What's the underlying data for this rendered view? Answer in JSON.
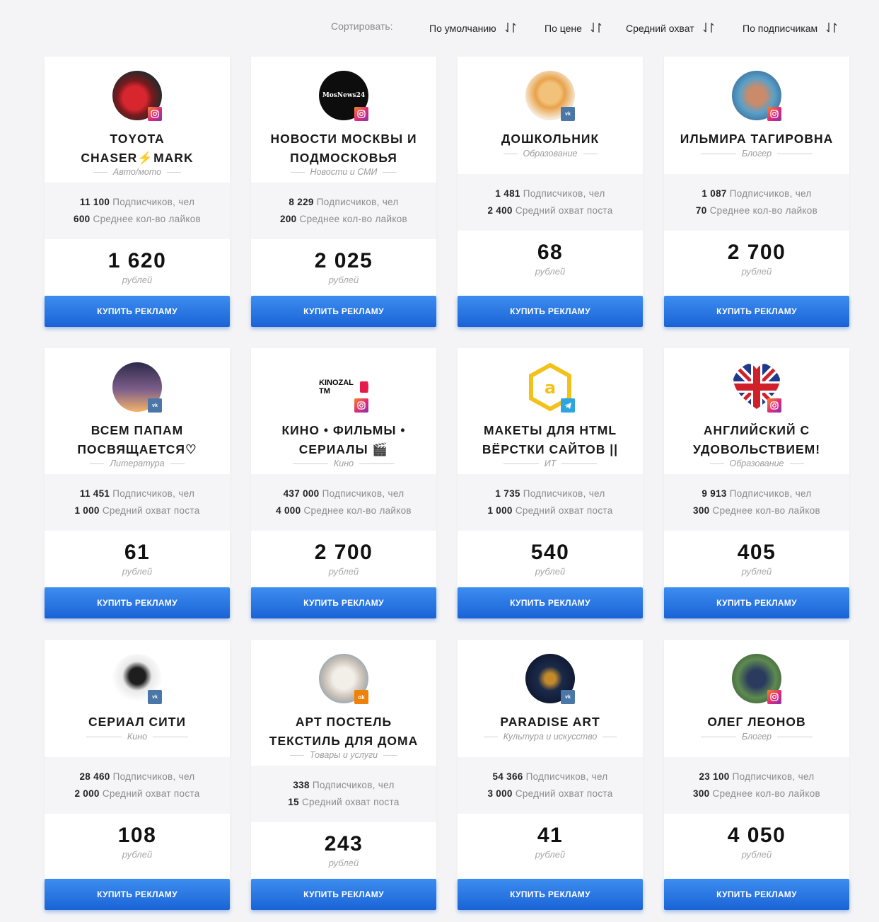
{
  "sort": {
    "label": "Сортировать:",
    "options": [
      "По умолчанию",
      "По цене",
      "Средний охват",
      "По подписчикам"
    ]
  },
  "buy_label": "КУПИТЬ РЕКЛАМУ",
  "price_unit": "рублей",
  "cards": [
    {
      "network": "instagram",
      "title_l1": "TOYOTA",
      "title_l2": "CHASER⚡MARK",
      "category": "Авто/мото",
      "stat1_value": "11 100",
      "stat1_label": "Подписчиков, чел",
      "stat2_value": "600",
      "stat2_label": "Среднее кол-во лайков",
      "price": "1 620"
    },
    {
      "network": "instagram",
      "title_l1": "НОВОСТИ МОСКВЫ И",
      "title_l2": "ПОДМОСКОВЬЯ",
      "category": "Новости и СМИ",
      "avatar_text": "MosNews24",
      "stat1_value": "8 229",
      "stat1_label": "Подписчиков, чел",
      "stat2_value": "200",
      "stat2_label": "Среднее кол-во лайков",
      "price": "2 025"
    },
    {
      "network": "vk",
      "title_l1": "ДОШКОЛЬНИК",
      "title_l2": "",
      "category": "Образование",
      "stat1_value": "1 481",
      "stat1_label": "Подписчиков, чел",
      "stat2_value": "2 400",
      "stat2_label": "Средний охват поста",
      "price": "68"
    },
    {
      "network": "instagram",
      "title_l1": "ИЛЬМИРА ТАГИРОВНА",
      "title_l2": "",
      "category": "Блогер",
      "stat1_value": "1 087",
      "stat1_label": "Подписчиков, чел",
      "stat2_value": "70",
      "stat2_label": "Среднее кол-во лайков",
      "price": "2 700"
    },
    {
      "network": "vk",
      "title_l1": "ВСЕМ ПАПАМ",
      "title_l2": "ПОСВЯЩАЕТСЯ♡",
      "category": "Литература",
      "stat1_value": "11 451",
      "stat1_label": "Подписчиков, чел",
      "stat2_value": "1 000",
      "stat2_label": "Средний охват поста",
      "price": "61"
    },
    {
      "network": "instagram",
      "title_l1": "КИНО • ФИЛЬМЫ •",
      "title_l2": "СЕРИАЛЫ 🎬",
      "category": "Кино",
      "avatar_text": "KINOZAL TM",
      "stat1_value": "437 000",
      "stat1_label": "Подписчиков, чел",
      "stat2_value": "4 000",
      "stat2_label": "Среднее кол-во лайков",
      "price": "2 700"
    },
    {
      "network": "telegram",
      "title_l1": "МАКЕТЫ ДЛЯ HTML",
      "title_l2": "ВЁРСТКИ САЙТОВ ||",
      "category": "ИТ",
      "avatar_text": "a",
      "stat1_value": "1 735",
      "stat1_label": "Подписчиков, чел",
      "stat2_value": "1 000",
      "stat2_label": "Средний охват поста",
      "price": "540"
    },
    {
      "network": "instagram",
      "title_l1": "АНГЛИЙСКИЙ С",
      "title_l2": "УДОВОЛЬСТВИЕМ!",
      "category": "Образование",
      "stat1_value": "9 913",
      "stat1_label": "Подписчиков, чел",
      "stat2_value": "300",
      "stat2_label": "Среднее кол-во лайков",
      "price": "405"
    },
    {
      "network": "vk",
      "title_l1": "СЕРИАЛ СИТИ",
      "title_l2": "",
      "category": "Кино",
      "stat1_value": "28 460",
      "stat1_label": "Подписчиков, чел",
      "stat2_value": "2 000",
      "stat2_label": "Средний охват поста",
      "price": "108"
    },
    {
      "network": "ok",
      "title_l1": "АРТ ПОСТЕЛЬ",
      "title_l2": "ТЕКСТИЛЬ ДЛЯ ДОМА",
      "category": "Товары и услуги",
      "stat1_value": "338",
      "stat1_label": "Подписчиков, чел",
      "stat2_value": "15",
      "stat2_label": "Средний охват поста",
      "price": "243"
    },
    {
      "network": "vk",
      "title_l1": "PARADISE ART",
      "title_l2": "",
      "category": "Культура и искусство",
      "stat1_value": "54 366",
      "stat1_label": "Подписчиков, чел",
      "stat2_value": "3 000",
      "stat2_label": "Средний охват поста",
      "price": "41"
    },
    {
      "network": "instagram",
      "title_l1": "ОЛЕГ ЛЕОНОВ",
      "title_l2": "",
      "category": "Блогер",
      "stat1_value": "23 100",
      "stat1_label": "Подписчиков, чел",
      "stat2_value": "300",
      "stat2_label": "Среднее кол-во лайков",
      "price": "4 050"
    }
  ]
}
